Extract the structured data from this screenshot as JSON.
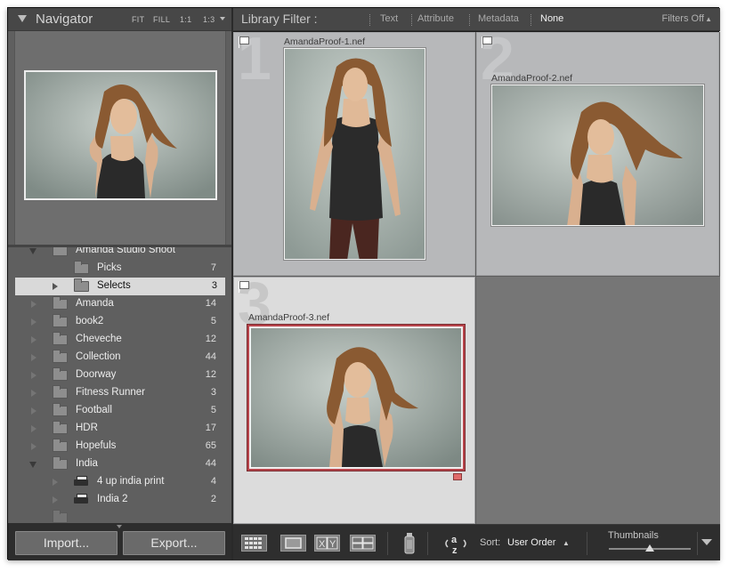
{
  "navigator": {
    "title": "Navigator",
    "zoom_options": [
      "FIT",
      "FILL",
      "1:1",
      "1:3"
    ]
  },
  "folders": [
    {
      "label": "Amanda Studio Shoot",
      "count": "",
      "expanded": true,
      "level": 0,
      "icon": "folder-icon"
    },
    {
      "label": "Picks",
      "count": "7",
      "level": 1,
      "icon": "folder-icon"
    },
    {
      "label": "Selects",
      "count": "3",
      "level": 1,
      "selected": true,
      "icon": "folder-icon"
    },
    {
      "label": "Amanda",
      "count": "14",
      "level": 0,
      "icon": "folder-icon"
    },
    {
      "label": "book2",
      "count": "5",
      "level": 0,
      "icon": "folder-icon"
    },
    {
      "label": "Cheveche",
      "count": "12",
      "level": 0,
      "icon": "folder-icon"
    },
    {
      "label": "Collection",
      "count": "44",
      "level": 0,
      "icon": "folder-icon"
    },
    {
      "label": "Doorway",
      "count": "12",
      "level": 0,
      "icon": "folder-icon"
    },
    {
      "label": "Fitness Runner",
      "count": "3",
      "level": 0,
      "icon": "folder-icon"
    },
    {
      "label": "Football",
      "count": "5",
      "level": 0,
      "icon": "folder-icon"
    },
    {
      "label": "HDR",
      "count": "17",
      "level": 0,
      "icon": "folder-icon"
    },
    {
      "label": "Hopefuls",
      "count": "65",
      "level": 0,
      "icon": "folder-icon"
    },
    {
      "label": "India",
      "count": "44",
      "level": 0,
      "expanded": true,
      "icon": "folder-icon"
    },
    {
      "label": "4 up india print",
      "count": "4",
      "level": 1,
      "icon": "printer-icon"
    },
    {
      "label": "India 2",
      "count": "2",
      "level": 1,
      "icon": "printer-icon"
    }
  ],
  "buttons": {
    "import": "Import...",
    "export": "Export..."
  },
  "filter_bar": {
    "title": "Library Filter :",
    "options": [
      "Text",
      "Attribute",
      "Metadata",
      "None"
    ],
    "active": "None",
    "filters_off": "Filters Off"
  },
  "grid": {
    "cells": [
      {
        "index": "1",
        "filename": "AmandaProof-1.nef"
      },
      {
        "index": "2",
        "filename": "AmandaProof-2.nef"
      },
      {
        "index": "3",
        "filename": "AmandaProof-3.nef",
        "selected": true
      }
    ]
  },
  "toolbar": {
    "sort_label": "Sort:",
    "sort_value": "User Order",
    "thumbnails_label": "Thumbnails",
    "thumbnail_size": 0.5,
    "view_icons": [
      "grid-view-icon",
      "loupe-view-icon",
      "compare-view-icon",
      "survey-view-icon",
      "painter-spray-can-icon",
      "sort-direction-icon"
    ]
  },
  "colors": {
    "selection_border": "#b8444b",
    "color_label": "#e06b6b"
  }
}
